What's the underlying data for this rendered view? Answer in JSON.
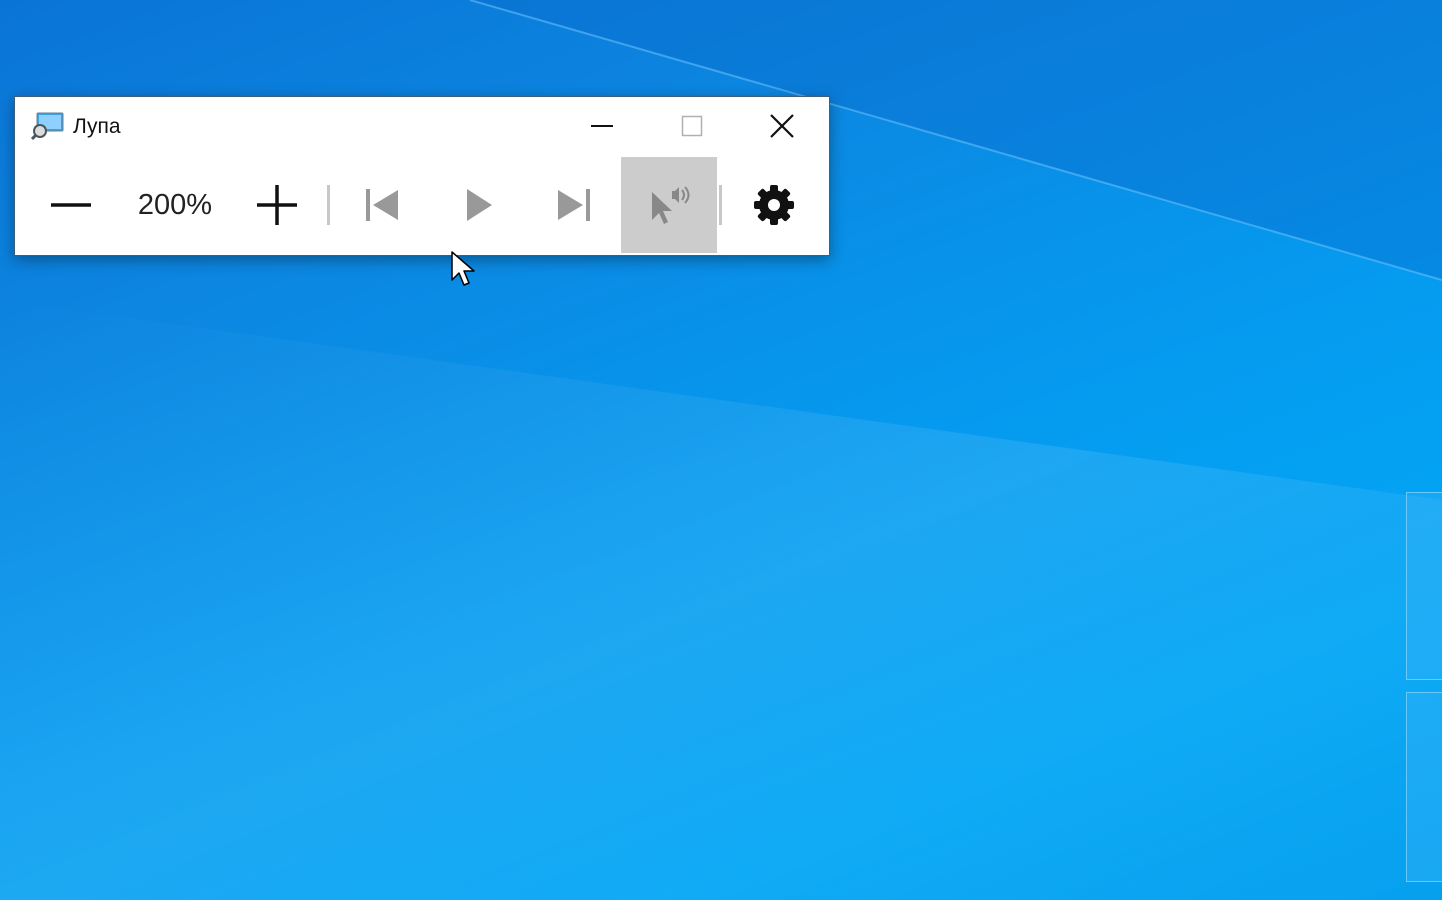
{
  "desktop": {
    "background_color": "#0795ea"
  },
  "magnifier": {
    "title": "Лупа",
    "zoom_level": "200%",
    "caption_buttons": {
      "minimize": "minimize-icon",
      "maximize": "maximize-icon",
      "close": "close-icon"
    },
    "toolbar": {
      "zoom_out_icon": "minus-icon",
      "zoom_in_icon": "plus-icon",
      "previous_icon": "skip-previous-icon",
      "play_icon": "play-icon",
      "next_icon": "skip-next-icon",
      "read_from_here_icon": "pointer-speaker-icon",
      "read_from_here_active": true,
      "settings_icon": "gear-icon"
    },
    "colors": {
      "disabled_icon": "#999999",
      "active_bg": "#cccccc",
      "border": "#3b5f80"
    }
  }
}
